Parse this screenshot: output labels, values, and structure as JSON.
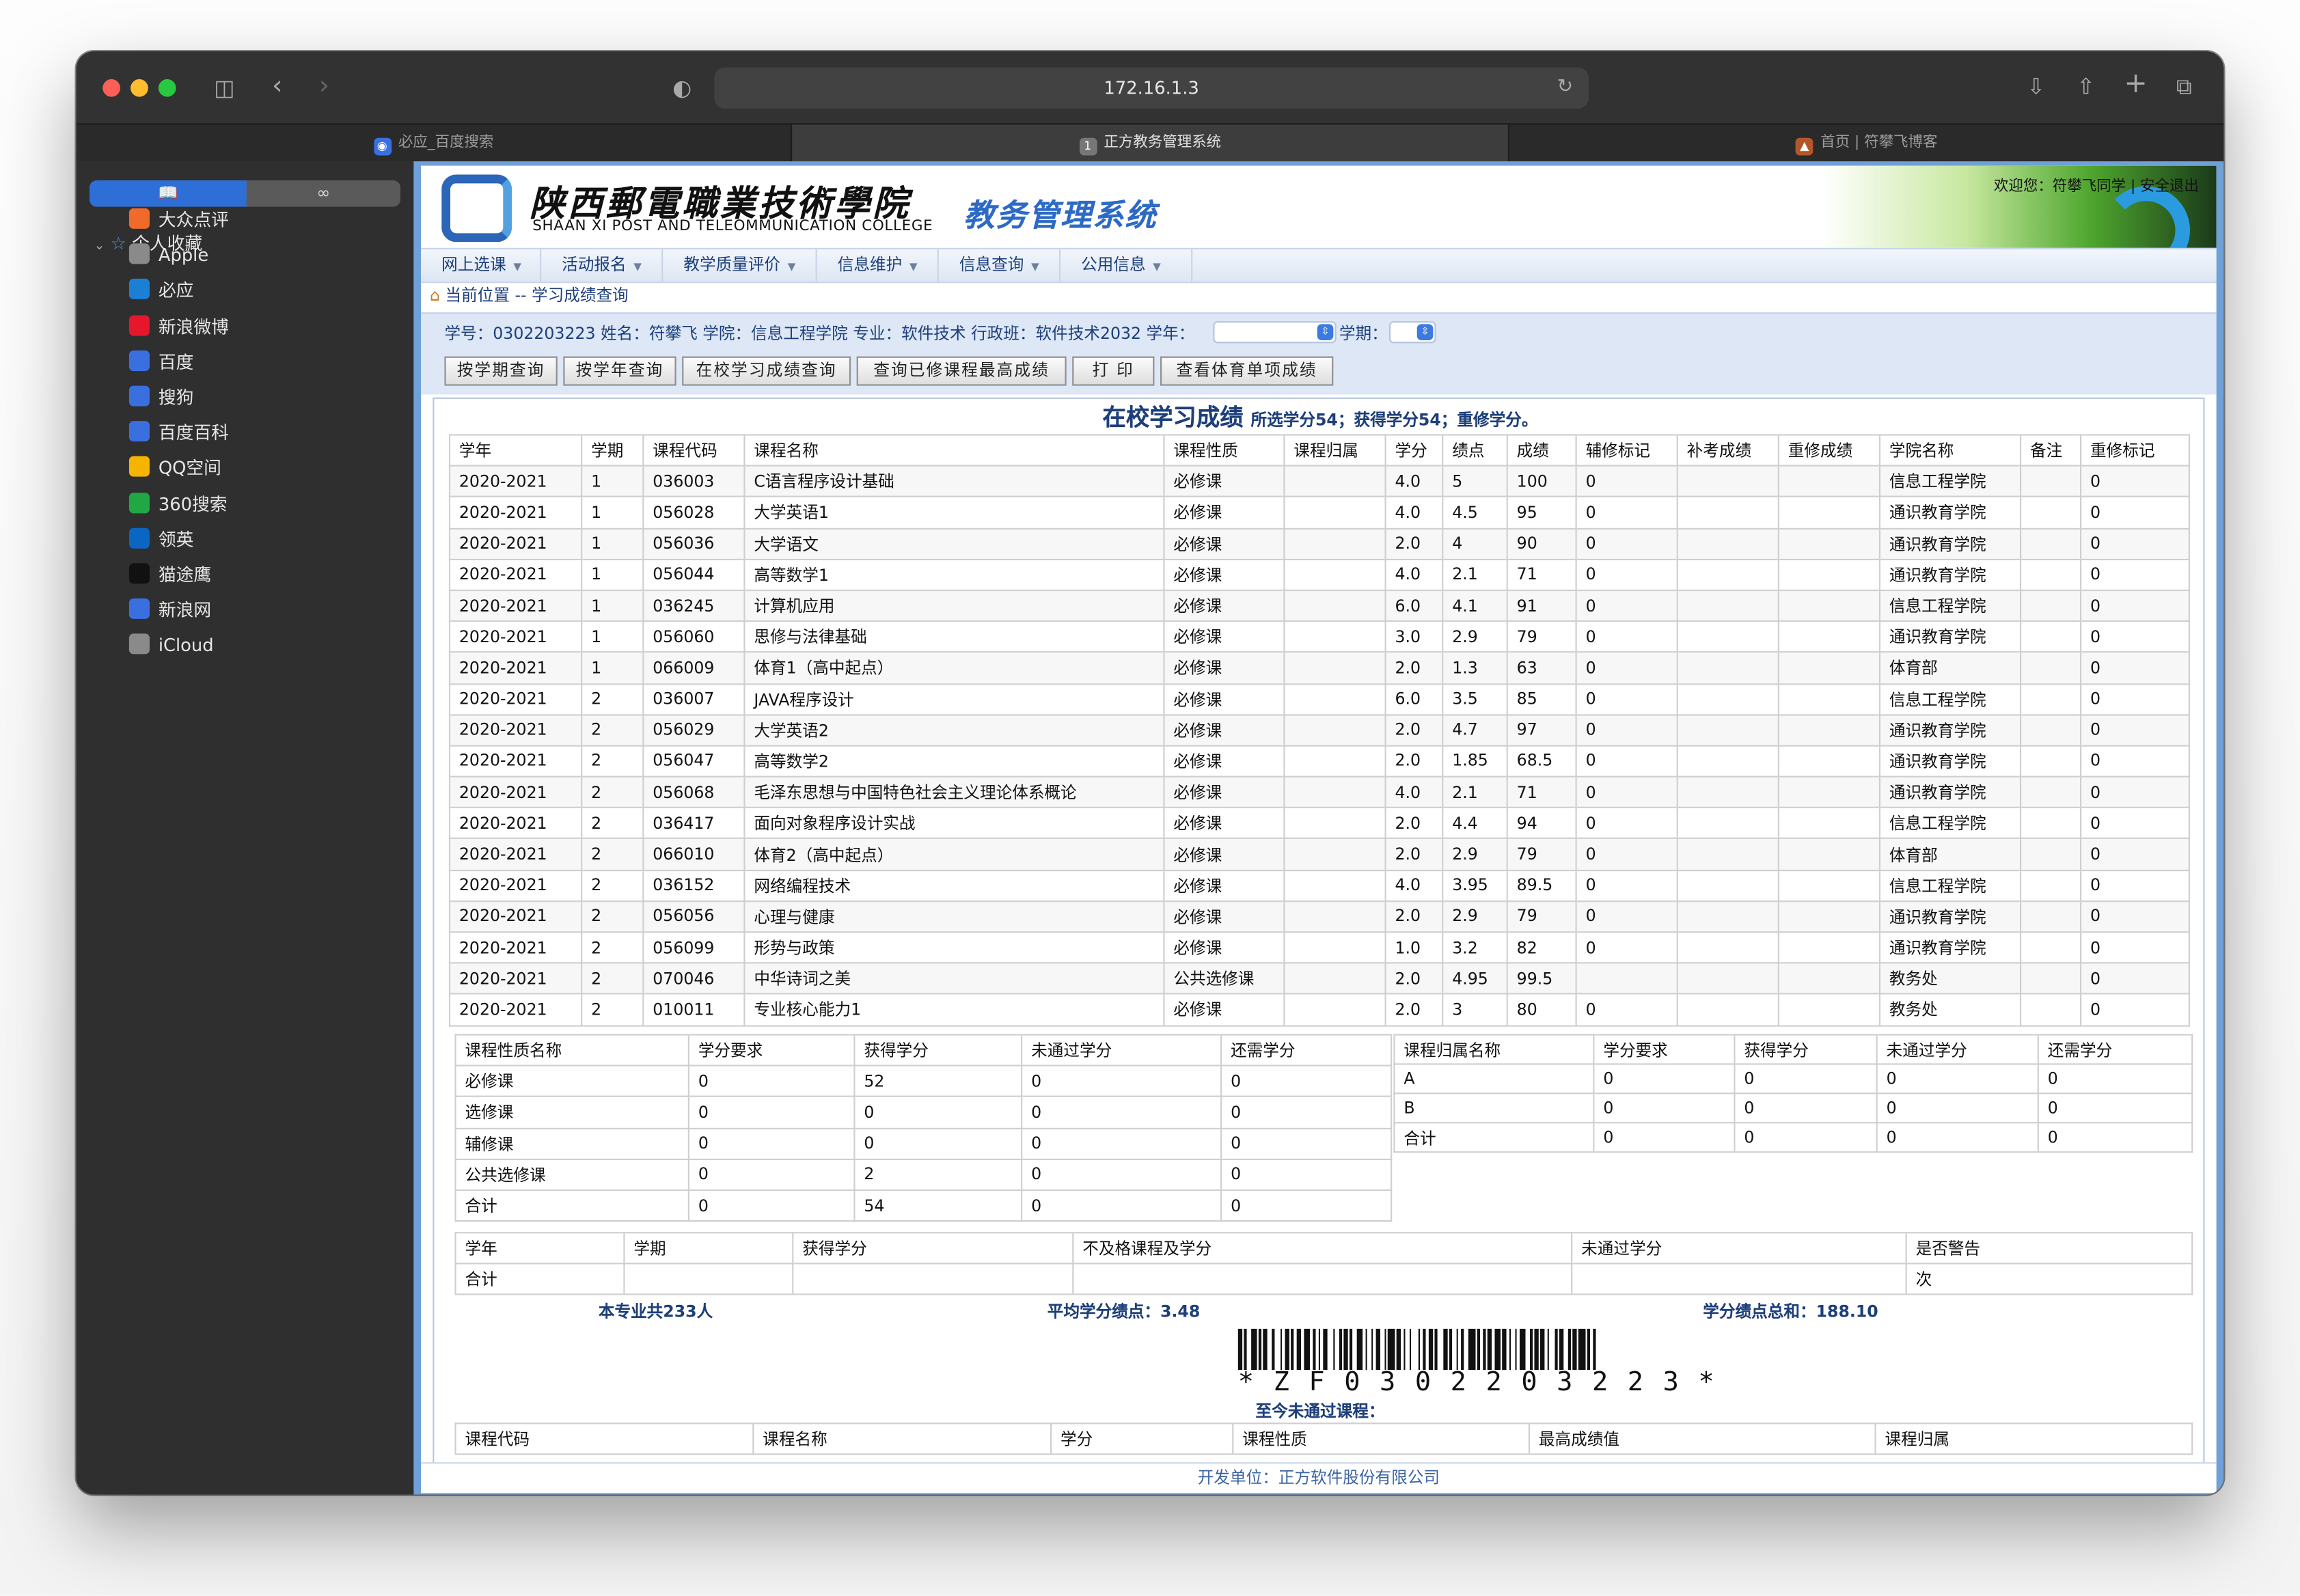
{
  "browser": {
    "url": "172.16.1.3",
    "tabs": [
      {
        "label": "必应_百度搜索",
        "active": false
      },
      {
        "label": "正方教务管理系统",
        "active": true
      },
      {
        "label": "首页 | 符攀飞博客",
        "active": false
      }
    ]
  },
  "sidebar": {
    "section_label": "个人收藏",
    "items": [
      {
        "label": "大众点评",
        "icon": "dianping-icon",
        "color": "#f06a2b"
      },
      {
        "label": "Apple",
        "icon": "apple-icon",
        "color": "#8a8a8a"
      },
      {
        "label": "必应",
        "icon": "bing-icon",
        "color": "#1b7fd4"
      },
      {
        "label": "新浪微博",
        "icon": "weibo-icon",
        "color": "#e6162d"
      },
      {
        "label": "百度",
        "icon": "baidu-icon",
        "color": "#3a6fe0"
      },
      {
        "label": "搜狗",
        "icon": "globe-icon",
        "color": "#3a6fe0"
      },
      {
        "label": "百度百科",
        "icon": "baidu-icon",
        "color": "#3a6fe0"
      },
      {
        "label": "QQ空间",
        "icon": "star-icon",
        "color": "#f5b400"
      },
      {
        "label": "360搜索",
        "icon": "ring-icon",
        "color": "#22a745"
      },
      {
        "label": "领英",
        "icon": "linkedin-icon",
        "color": "#0a66c2"
      },
      {
        "label": "猫途鹰",
        "icon": "tripadvisor-icon",
        "color": "#111111"
      },
      {
        "label": "新浪网",
        "icon": "globe-icon",
        "color": "#3a6fe0"
      },
      {
        "label": "iCloud",
        "icon": "apple-icon",
        "color": "#8a8a8a"
      }
    ]
  },
  "header": {
    "school_cn": "陕西郵電職業技術學院",
    "school_en": "SHAAN XI POST AND TELEOMMUNICATION COLLEGE",
    "system_title": "教务管理系统",
    "welcome": "欢迎您：符攀飞同学 | 安全退出"
  },
  "menu": [
    "网上选课",
    "活动报名",
    "教学质量评价",
    "信息维护",
    "信息查询",
    "公用信息"
  ],
  "breadcrumb": "当前位置 -- 学习成绩查询",
  "student_info": "学号：0302203223 姓名：符攀飞 学院：信息工程学院 专业：软件技术 行政班：软件技术2032  学年：",
  "term_label": "学期：",
  "buttons": [
    "按学期查询",
    "按学年查询",
    "在校学习成绩查询",
    "查询已修课程最高成绩",
    "打 印",
    "查看体育单项成绩"
  ],
  "report": {
    "title": "在校学习成绩",
    "subtitle": "所选学分54；获得学分54；重修学分。"
  },
  "grades_header": [
    "学年",
    "学期",
    "课程代码",
    "课程名称",
    "课程性质",
    "课程归属",
    "学分",
    "绩点",
    "成绩",
    "辅修标记",
    "补考成绩",
    "重修成绩",
    "学院名称",
    "备注",
    "重修标记"
  ],
  "grades": [
    [
      "2020-2021",
      "1",
      "036003",
      "C语言程序设计基础",
      "必修课",
      "",
      "4.0",
      "5",
      "100",
      "0",
      "",
      "",
      "信息工程学院",
      "",
      "0"
    ],
    [
      "2020-2021",
      "1",
      "056028",
      "大学英语1",
      "必修课",
      "",
      "4.0",
      "4.5",
      "95",
      "0",
      "",
      "",
      "通识教育学院",
      "",
      "0"
    ],
    [
      "2020-2021",
      "1",
      "056036",
      "大学语文",
      "必修课",
      "",
      "2.0",
      "4",
      "90",
      "0",
      "",
      "",
      "通识教育学院",
      "",
      "0"
    ],
    [
      "2020-2021",
      "1",
      "056044",
      "高等数学1",
      "必修课",
      "",
      "4.0",
      "2.1",
      "71",
      "0",
      "",
      "",
      "通识教育学院",
      "",
      "0"
    ],
    [
      "2020-2021",
      "1",
      "036245",
      "计算机应用",
      "必修课",
      "",
      "6.0",
      "4.1",
      "91",
      "0",
      "",
      "",
      "信息工程学院",
      "",
      "0"
    ],
    [
      "2020-2021",
      "1",
      "056060",
      "思修与法律基础",
      "必修课",
      "",
      "3.0",
      "2.9",
      "79",
      "0",
      "",
      "",
      "通识教育学院",
      "",
      "0"
    ],
    [
      "2020-2021",
      "1",
      "066009",
      "体育1（高中起点）",
      "必修课",
      "",
      "2.0",
      "1.3",
      "63",
      "0",
      "",
      "",
      "体育部",
      "",
      "0"
    ],
    [
      "2020-2021",
      "2",
      "036007",
      "JAVA程序设计",
      "必修课",
      "",
      "6.0",
      "3.5",
      "85",
      "0",
      "",
      "",
      "信息工程学院",
      "",
      "0"
    ],
    [
      "2020-2021",
      "2",
      "056029",
      "大学英语2",
      "必修课",
      "",
      "2.0",
      "4.7",
      "97",
      "0",
      "",
      "",
      "通识教育学院",
      "",
      "0"
    ],
    [
      "2020-2021",
      "2",
      "056047",
      "高等数学2",
      "必修课",
      "",
      "2.0",
      "1.85",
      "68.5",
      "0",
      "",
      "",
      "通识教育学院",
      "",
      "0"
    ],
    [
      "2020-2021",
      "2",
      "056068",
      "毛泽东思想与中国特色社会主义理论体系概论",
      "必修课",
      "",
      "4.0",
      "2.1",
      "71",
      "0",
      "",
      "",
      "通识教育学院",
      "",
      "0"
    ],
    [
      "2020-2021",
      "2",
      "036417",
      "面向对象程序设计实战",
      "必修课",
      "",
      "2.0",
      "4.4",
      "94",
      "0",
      "",
      "",
      "信息工程学院",
      "",
      "0"
    ],
    [
      "2020-2021",
      "2",
      "066010",
      "体育2（高中起点）",
      "必修课",
      "",
      "2.0",
      "2.9",
      "79",
      "0",
      "",
      "",
      "体育部",
      "",
      "0"
    ],
    [
      "2020-2021",
      "2",
      "036152",
      "网络编程技术",
      "必修课",
      "",
      "4.0",
      "3.95",
      "89.5",
      "0",
      "",
      "",
      "信息工程学院",
      "",
      "0"
    ],
    [
      "2020-2021",
      "2",
      "056056",
      "心理与健康",
      "必修课",
      "",
      "2.0",
      "2.9",
      "79",
      "0",
      "",
      "",
      "通识教育学院",
      "",
      "0"
    ],
    [
      "2020-2021",
      "2",
      "056099",
      "形势与政策",
      "必修课",
      "",
      "1.0",
      "3.2",
      "82",
      "0",
      "",
      "",
      "通识教育学院",
      "",
      "0"
    ],
    [
      "2020-2021",
      "2",
      "070046",
      "中华诗词之美",
      "公共选修课",
      "",
      "2.0",
      "4.95",
      "99.5",
      "",
      "",
      "",
      "教务处",
      "",
      "0"
    ],
    [
      "2020-2021",
      "2",
      "010011",
      "专业核心能力1",
      "必修课",
      "",
      "2.0",
      "3",
      "80",
      "0",
      "",
      "",
      "教务处",
      "",
      "0"
    ]
  ],
  "nature_summary": {
    "header": [
      "课程性质名称",
      "学分要求",
      "获得学分",
      "未通过学分",
      "还需学分"
    ],
    "rows": [
      [
        "必修课",
        "0",
        "52",
        "0",
        "0"
      ],
      [
        "选修课",
        "0",
        "0",
        "0",
        "0"
      ],
      [
        "辅修课",
        "0",
        "0",
        "0",
        "0"
      ],
      [
        "公共选修课",
        "0",
        "2",
        "0",
        "0"
      ],
      [
        "合计",
        "0",
        "54",
        "0",
        "0"
      ]
    ]
  },
  "belong_summary": {
    "header": [
      "课程归属名称",
      "学分要求",
      "获得学分",
      "未通过学分",
      "还需学分"
    ],
    "rows": [
      [
        "A",
        "0",
        "0",
        "0",
        "0"
      ],
      [
        "B",
        "0",
        "0",
        "0",
        "0"
      ],
      [
        "合计",
        "0",
        "0",
        "0",
        "0"
      ]
    ]
  },
  "year_summary": {
    "header": [
      "学年",
      "学期",
      "获得学分",
      "不及格课程及学分",
      "未通过学分",
      "是否警告"
    ],
    "rows": [
      [
        "合计",
        "",
        "",
        "",
        "",
        "次"
      ]
    ]
  },
  "stats": {
    "major_count": "本专业共233人",
    "avg_gpa": "平均学分绩点：3.48",
    "gpa_sum": "学分绩点总和：188.10"
  },
  "barcode_text": "*ZF0302203223*",
  "failed_title": "至今未通过课程：",
  "failed_header": [
    "课程代码",
    "课程名称",
    "学分",
    "课程性质",
    "最高成绩值",
    "课程归属"
  ],
  "footer": "开发单位：正方软件股份有限公司"
}
